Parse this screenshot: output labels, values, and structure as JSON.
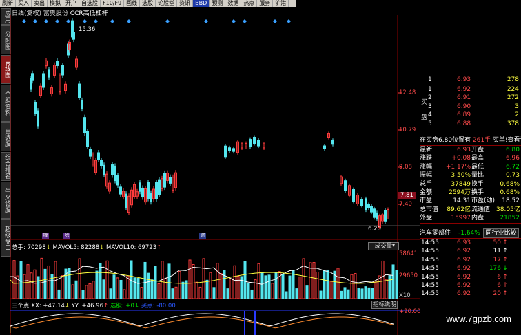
{
  "toolbar": {
    "items": [
      "刷新",
      "买入",
      "卖出",
      "模拟",
      "开户",
      "自选股",
      "F10/F9",
      "画线",
      "选股",
      "论股堂",
      "资讯",
      "BBD",
      "预测",
      "数据",
      "热点",
      "服务",
      "沪港"
    ],
    "active_index": 11
  },
  "sidebar": {
    "items": [
      "应用",
      "分时图",
      "K线图",
      "个股资料",
      "自选股",
      "综合排名",
      "牛叉诊股",
      "超级盘口"
    ],
    "active_index": 2
  },
  "chart": {
    "title_prefix": "日线(复权)",
    "stock_name": "富奥股份",
    "indicator": "CCR高低杠杆",
    "high_label": "15.36",
    "low_label": "6.20",
    "y_ticks": [
      "12.48",
      "10.79",
      "9.08",
      "7.40"
    ],
    "current_price_tag": "7.81",
    "event_markers": [
      "權",
      "除",
      "财"
    ],
    "colors": {
      "up": "#ff3c3c",
      "down": "#54e6ef",
      "grid": "#8b0000",
      "diamond": "#3aa0ff"
    }
  },
  "volume": {
    "total_label": "总手: 70298",
    "ma5_label": "MAVOL5: 82288",
    "ma10_label": "MAVOL10: 69723",
    "selector": "成交量",
    "y_ticks": [
      "58641",
      "29650",
      "X10"
    ]
  },
  "indicator_pane": {
    "name": "三个点",
    "xx_label": "XX: +47.14",
    "yy_label": "YY: +46.96",
    "select_label": "选股: +0",
    "extra_label": "买点: -80.00",
    "help_button": "指标说明",
    "y_tick": "+90.00"
  },
  "order_book": {
    "sell": [
      {
        "level": "1",
        "price": "6.93",
        "vol": "278"
      }
    ],
    "buy_header": [
      "买",
      "盘"
    ],
    "buy": [
      {
        "level": "1",
        "price": "6.92",
        "vol": "224"
      },
      {
        "level": "2",
        "price": "6.91",
        "vol": "272"
      },
      {
        "level": "3",
        "price": "6.90",
        "vol": "3"
      },
      {
        "level": "4",
        "price": "6.89",
        "vol": "2"
      },
      {
        "level": "5",
        "price": "6.88",
        "vol": "378"
      }
    ],
    "notice_left": "在买盘6.80位置有",
    "notice_mid": "261手",
    "notice_right": "买单!查看详细"
  },
  "quote": [
    {
      "l": "最新",
      "v": "6.93",
      "vc": "red",
      "l2": "开盘",
      "v2": "6.80",
      "v2c": "green"
    },
    {
      "l": "涨跌",
      "v": "+0.08",
      "vc": "red",
      "l2": "最高",
      "v2": "6.96",
      "v2c": "red"
    },
    {
      "l": "涨幅",
      "v": "+1.17%",
      "vc": "red",
      "l2": "最低",
      "v2": "6.72",
      "v2c": "green"
    },
    {
      "l": "振幅",
      "v": "3.50%",
      "vc": "yellow",
      "l2": "量比",
      "v2": "0.73",
      "v2c": "yellow"
    },
    {
      "l": "总手",
      "v": "37849",
      "vc": "yellow",
      "l2": "换手",
      "v2": "0.68%",
      "v2c": "yellow"
    },
    {
      "l": "金额",
      "v": "2594万",
      "vc": "yellow",
      "l2": "换手",
      "v2": "0.68%",
      "v2c": "yellow"
    },
    {
      "l": "市盈",
      "v": "14.31",
      "vc": "white",
      "l2": "市盈(动)",
      "v2": "18.52",
      "v2c": "white"
    },
    {
      "l": "总市值",
      "v": "89.62亿",
      "vc": "yellow",
      "l2": "流通值",
      "v2": "38.05亿",
      "v2c": "yellow"
    },
    {
      "l": "外盘",
      "v": "15997",
      "vc": "red",
      "l2": "内盘",
      "v2": "21852",
      "v2c": "green"
    }
  ],
  "sector": {
    "name": "汽车零部件",
    "change": "-1.64%",
    "button": "同行业比较"
  },
  "trades": [
    {
      "time": "14:55",
      "price": "6.93",
      "pc": "red",
      "vol": "50",
      "vc": "red",
      "dir": "↑",
      "dc": "red"
    },
    {
      "time": "14:55",
      "price": "6.92",
      "pc": "red",
      "vol": "11",
      "vc": "white",
      "dir": "↑",
      "dc": "white"
    },
    {
      "time": "14:55",
      "price": "6.92",
      "pc": "red",
      "vol": "17",
      "vc": "red",
      "dir": "↑",
      "dc": "red"
    },
    {
      "time": "14:55",
      "price": "6.92",
      "pc": "red",
      "vol": "176",
      "vc": "green",
      "dir": "↓",
      "dc": "green"
    },
    {
      "time": "14:55",
      "price": "6.92",
      "pc": "red",
      "vol": "6",
      "vc": "red",
      "dir": "↑",
      "dc": "red"
    },
    {
      "time": "14:55",
      "price": "6.92",
      "pc": "red",
      "vol": "6",
      "vc": "red",
      "dir": "↑",
      "dc": "red"
    },
    {
      "time": "14:55",
      "price": "6.92",
      "pc": "red",
      "vol": "20",
      "vc": "red",
      "dir": "↑",
      "dc": "red"
    }
  ],
  "watermark": "www.7gpzb.com"
}
